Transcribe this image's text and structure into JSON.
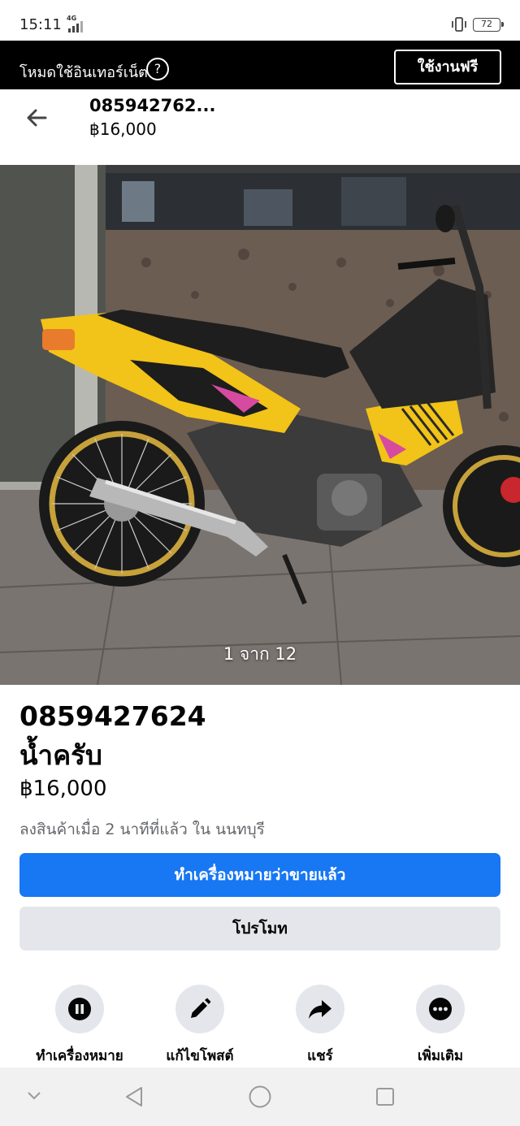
{
  "status_bar": {
    "time": "15:11",
    "network": "4G",
    "battery": "72",
    "icons": [
      "signal-icon",
      "vibrate-icon",
      "battery-icon"
    ]
  },
  "banner": {
    "text": "โหมดใช้อินเทอร์เน็ต",
    "help_icon": "?",
    "free_button": "ใช้งานฟรี"
  },
  "header": {
    "title": "085942762...",
    "price": "฿16,000",
    "back_icon": "back-arrow-icon"
  },
  "photo": {
    "counter": "1 จาก 12",
    "colors": {
      "fairing": "#f2c318",
      "wall": "#5c514a",
      "floor": "#7a7470"
    }
  },
  "listing": {
    "title_line1": "0859427624",
    "title_line2": "น้ำครับ",
    "price": "฿16,000",
    "meta": "ลงสินค้าเมื่อ 2 นาทีที่แล้ว ใน นนทบุรี"
  },
  "buttons": {
    "mark_sold": "ทำเครื่องหมายว่าขายแล้ว",
    "promote": "โปรโมท"
  },
  "actions": [
    {
      "label": "ทำเครื่องหมาย",
      "icon": "pause-icon"
    },
    {
      "label": "แก้ไขโพสต์",
      "icon": "pencil-icon"
    },
    {
      "label": "แชร์",
      "icon": "share-icon"
    },
    {
      "label": "เพิ่มเติม",
      "icon": "more-icon"
    }
  ],
  "nav_bar": {
    "icons": [
      "chevron-down-icon",
      "back-triangle-icon",
      "home-circle-icon",
      "recents-square-icon"
    ]
  },
  "colors": {
    "accent": "#1877f2",
    "secondary_button": "#e4e6eb",
    "banner": "#000000",
    "meta_text": "#65676b"
  }
}
